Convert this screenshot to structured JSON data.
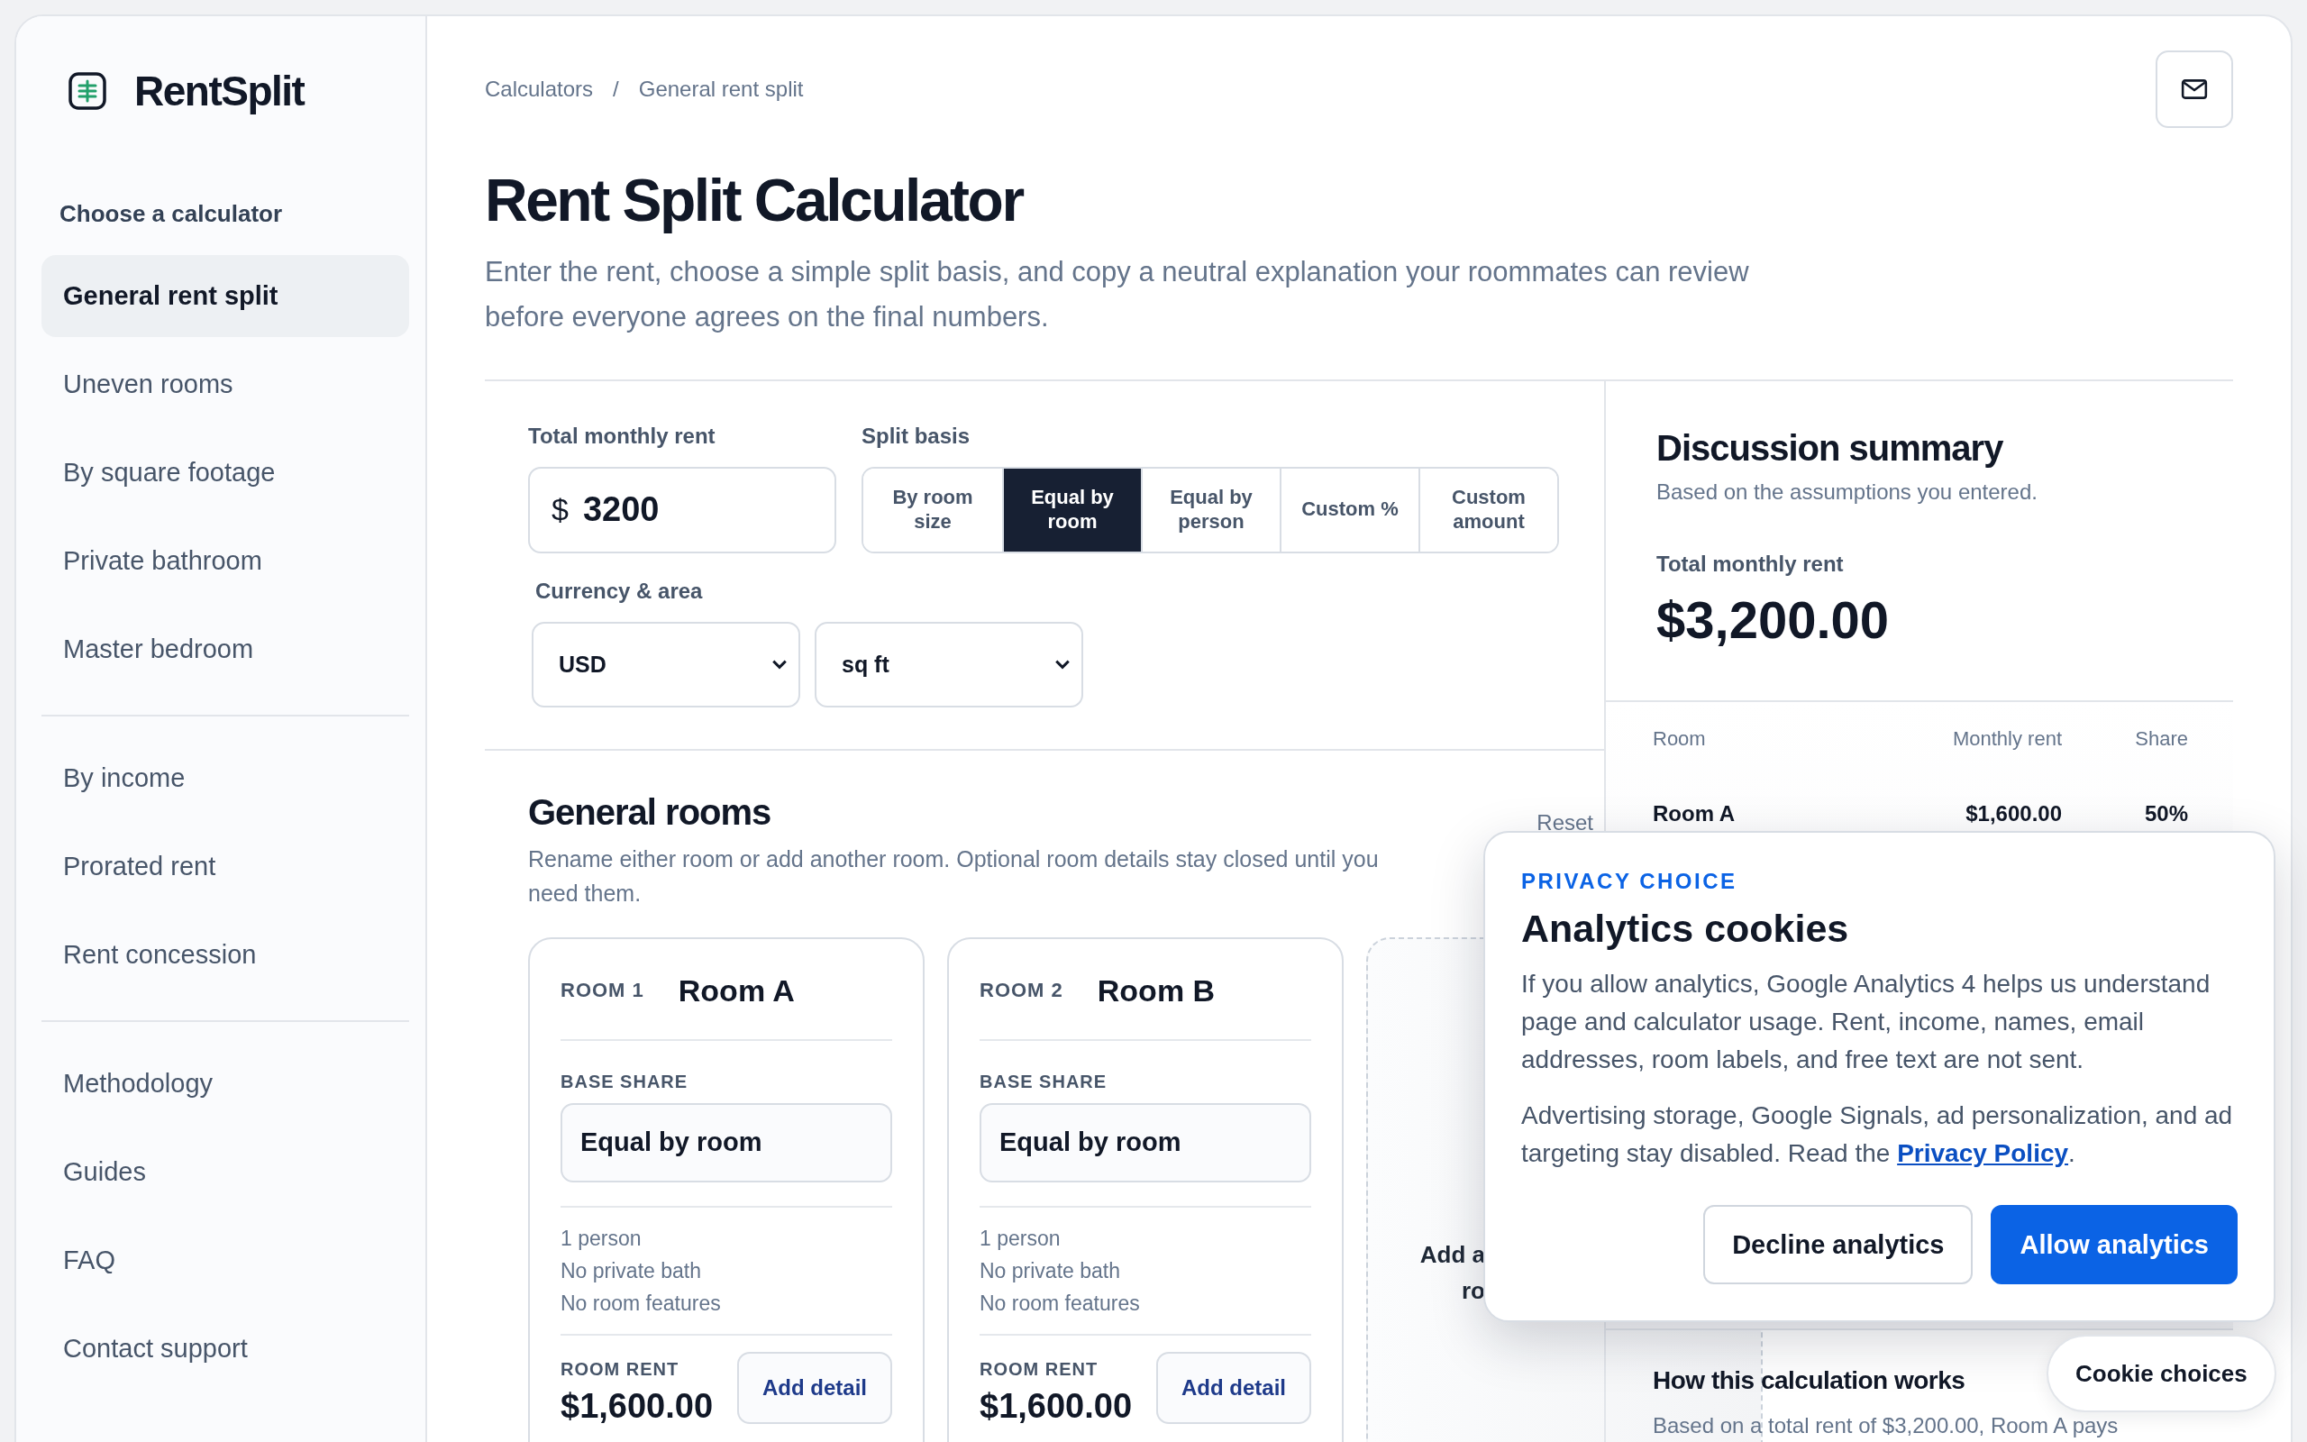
{
  "sidebar": {
    "brand": "RentSplit",
    "section_title": "Choose a calculator",
    "groups": [
      {
        "items": [
          {
            "label": "General rent split",
            "selected": true
          },
          {
            "label": "Uneven rooms",
            "selected": false
          },
          {
            "label": "By square footage",
            "selected": false
          },
          {
            "label": "Private bathroom",
            "selected": false
          },
          {
            "label": "Master bedroom",
            "selected": false
          }
        ]
      },
      {
        "items": [
          {
            "label": "By income",
            "selected": false
          },
          {
            "label": "Prorated rent",
            "selected": false
          },
          {
            "label": "Rent concession",
            "selected": false
          }
        ]
      },
      {
        "items": [
          {
            "label": "Methodology",
            "selected": false
          },
          {
            "label": "Guides",
            "selected": false
          },
          {
            "label": "FAQ",
            "selected": false
          },
          {
            "label": "Contact support",
            "selected": false
          }
        ]
      }
    ]
  },
  "breadcrumb": {
    "items": [
      "Calculators",
      "General rent split"
    ],
    "separator": "/"
  },
  "page": {
    "title": "Rent Split Calculator",
    "subtitle": "Enter the rent, choose a simple split basis, and copy a neutral explanation your roommates can review before everyone agrees on the final numbers."
  },
  "rent_form": {
    "rent_label": "Total monthly rent",
    "currency_symbol": "$",
    "rent_value": "3200",
    "split_label": "Split basis",
    "split_options": [
      {
        "label": "By room size",
        "selected": false
      },
      {
        "label": "Equal by room",
        "selected": true
      },
      {
        "label": "Equal by person",
        "selected": false
      },
      {
        "label": "Custom %",
        "selected": false
      },
      {
        "label": "Custom amount",
        "selected": false
      }
    ],
    "currency_label": "Currency & area",
    "currency_select": "USD",
    "area_select": "sq ft"
  },
  "rooms": {
    "title": "General rooms",
    "subtitle": "Rename either room or add another room. Optional room details stay closed until you need them.",
    "reset": "Reset",
    "cards": [
      {
        "number_label": "ROOM 1",
        "name": "Room A",
        "base_share_label": "BASE SHARE",
        "base_share": "Equal by room",
        "details": [
          "1 person",
          "No private bath",
          "No room features"
        ],
        "rent_label": "ROOM RENT",
        "rent": "$1,600.00",
        "add_detail": "Add detail"
      },
      {
        "number_label": "ROOM 2",
        "name": "Room B",
        "base_share_label": "BASE SHARE",
        "base_share": "Equal by room",
        "details": [
          "1 person",
          "No private bath",
          "No room features"
        ],
        "rent_label": "ROOM RENT",
        "rent": "$1,600.00",
        "add_detail": "Add detail"
      }
    ],
    "add_room_lines": [
      "Add a",
      "ro"
    ]
  },
  "summary": {
    "title": "Discussion summary",
    "subtitle": "Based on the assumptions you entered.",
    "total_label": "Total monthly rent",
    "total": "$3,200.00",
    "columns": [
      "Room",
      "Monthly rent",
      "Share"
    ],
    "rows": [
      [
        "Room A",
        "$1,600.00",
        "50%"
      ]
    ],
    "how_title": "How this calculation works",
    "how_text": "Based on a total rent of $3,200.00, Room A pays"
  },
  "cookie_banner": {
    "eyebrow": "PRIVACY CHOICE",
    "title": "Analytics cookies",
    "paragraph": "If you allow analytics, Google Analytics 4 helps us understand page and calculator usage. Rent, income, names, email addresses, room labels, and free text are not sent.",
    "notice": {
      "text_before": "Advertising storage, Google Signals, ad personalization, and ad targeting stay disabled. Read the ",
      "link": "Privacy Policy",
      "text_after": "."
    },
    "buttons": [
      {
        "label": "Decline analytics",
        "kind": "secondary"
      },
      {
        "label": "Allow analytics",
        "kind": "primary"
      }
    ]
  },
  "cookie_choices": "Cookie choices"
}
